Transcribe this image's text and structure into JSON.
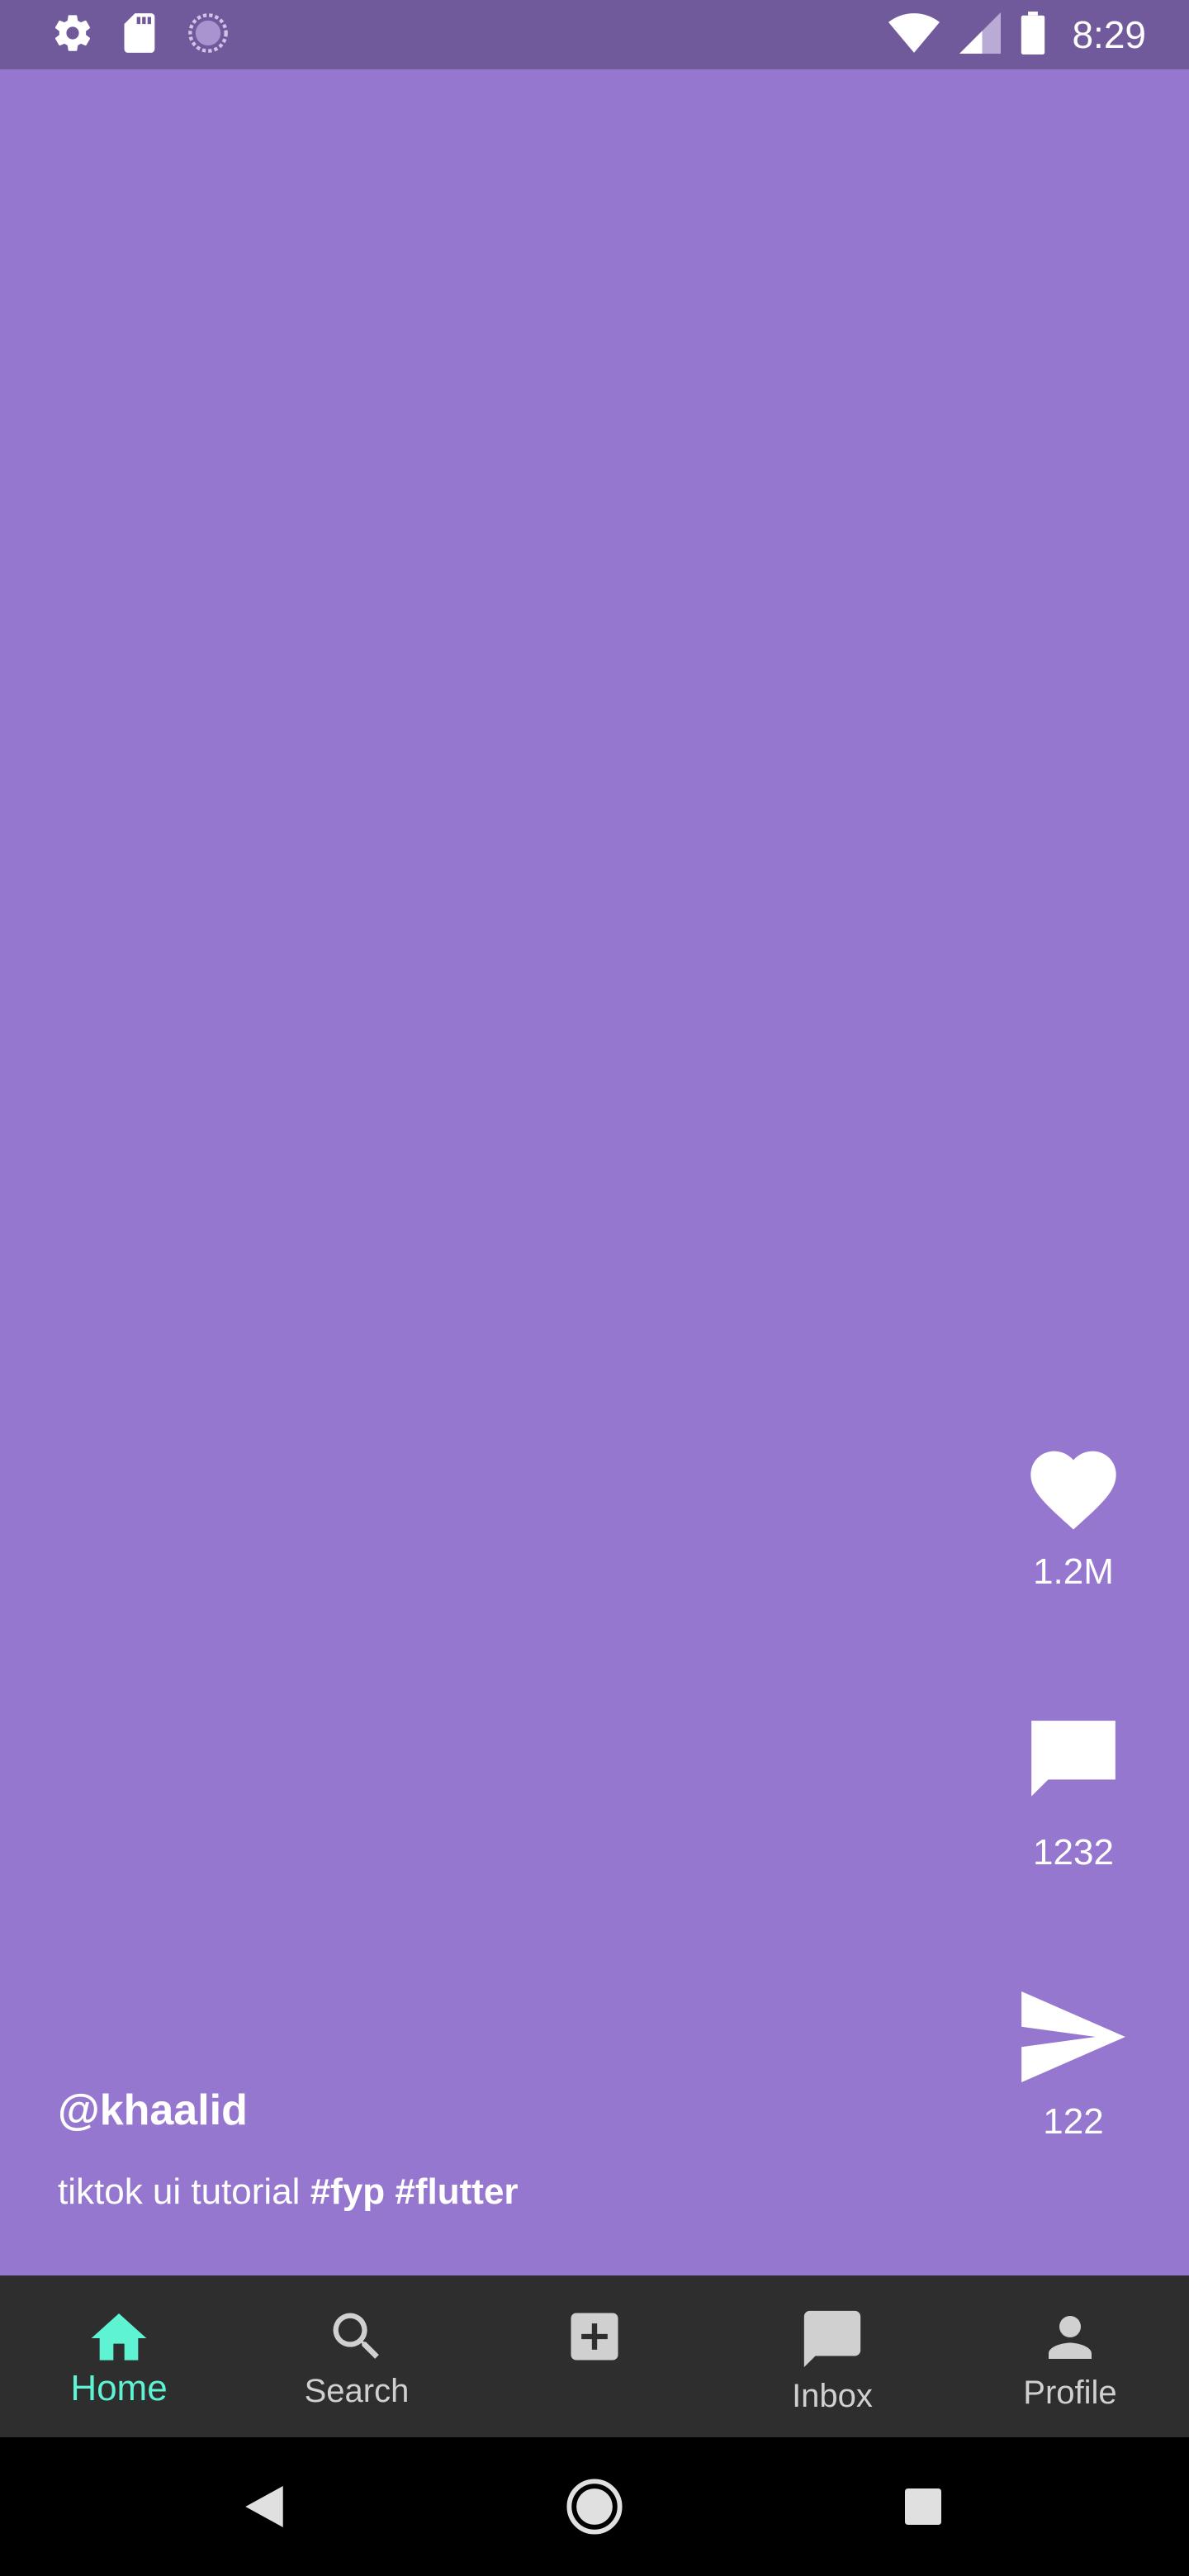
{
  "status_bar": {
    "time": "8:29",
    "left_icons": [
      "gear-icon",
      "sd-card-icon",
      "loading-icon"
    ],
    "right_icons": [
      "wifi-icon",
      "signal-icon",
      "battery-icon"
    ]
  },
  "video": {
    "background_color": "#9677cf",
    "username": "@khaalid",
    "description_text": "tiktok ui tutorial",
    "hashtags": [
      "#fyp",
      "#flutter"
    ]
  },
  "actions": {
    "likes": "1.2M",
    "comments": "1232",
    "shares": "122"
  },
  "bottom_nav": {
    "accent_color": "#5ef3d3",
    "items": [
      {
        "label": "Home",
        "icon": "home-icon",
        "active": true
      },
      {
        "label": "Search",
        "icon": "search-icon",
        "active": false
      },
      {
        "label": "",
        "icon": "add-box-icon",
        "active": false
      },
      {
        "label": "Inbox",
        "icon": "chat-bubble-icon",
        "active": false
      },
      {
        "label": "Profile",
        "icon": "person-icon",
        "active": false
      }
    ]
  },
  "system_nav": [
    "back-icon",
    "home-circle-icon",
    "recents-icon"
  ]
}
